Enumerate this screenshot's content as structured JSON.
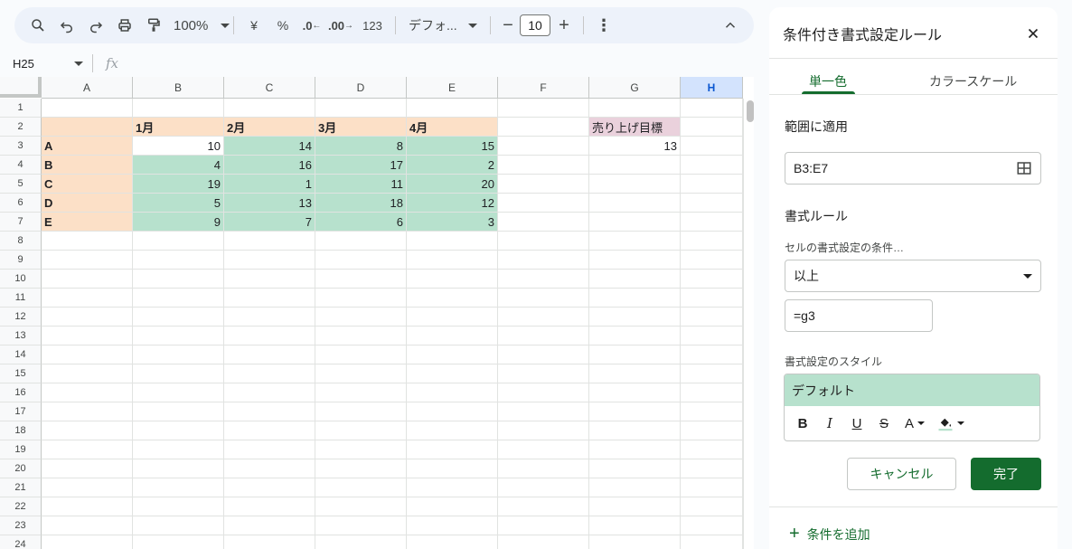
{
  "toolbar": {
    "zoom": "100%",
    "currency": "¥",
    "percent": "%",
    "decimal_decrease": ".0",
    "decimal_increase": ".00",
    "number_format": "123",
    "font": "デフォ...",
    "font_size": "10"
  },
  "name_box": {
    "value": "H25"
  },
  "formula_bar": {
    "fx": "fx"
  },
  "columns": [
    "A",
    "B",
    "C",
    "D",
    "E",
    "F",
    "G",
    "H"
  ],
  "selected_column": "H",
  "rows": [
    "1",
    "2",
    "3",
    "4",
    "5",
    "6",
    "7",
    "8",
    "9",
    "10",
    "11",
    "12",
    "13",
    "14",
    "15",
    "16",
    "17",
    "18",
    "19",
    "20",
    "21",
    "22",
    "23",
    "24"
  ],
  "sheet": {
    "headers": [
      "1月",
      "2月",
      "3月",
      "4月"
    ],
    "row_labels": [
      "A",
      "B",
      "C",
      "D",
      "E"
    ],
    "values": [
      [
        "10",
        "14",
        "8",
        "15"
      ],
      [
        "4",
        "16",
        "17",
        "2"
      ],
      [
        "19",
        "1",
        "11",
        "20"
      ],
      [
        "5",
        "13",
        "18",
        "12"
      ],
      [
        "9",
        "7",
        "6",
        "3"
      ]
    ],
    "highlighted": [
      [
        false,
        true,
        true,
        true
      ],
      [
        true,
        true,
        true,
        true
      ],
      [
        true,
        true,
        true,
        true
      ],
      [
        true,
        true,
        true,
        true
      ],
      [
        true,
        true,
        true,
        true
      ]
    ],
    "target_label": "売り上げ目標",
    "target_value": "13"
  },
  "colors": {
    "peach": "#fce0c7",
    "green": "#b7e1cd",
    "pink": "#ead1dc",
    "accent": "#146c2e"
  },
  "panel": {
    "title": "条件付き書式設定ルール",
    "tabs": [
      "単一色",
      "カラースケール"
    ],
    "range_label": "範囲に適用",
    "range_value": "B3:E7",
    "rules_label": "書式ルール",
    "condition_label": "セルの書式設定の条件…",
    "condition_value": "以上",
    "formula_value": "=g3",
    "style_label": "書式設定のスタイル",
    "style_preview": "デフォルト",
    "cancel": "キャンセル",
    "done": "完了",
    "add_rule": "条件を追加"
  }
}
